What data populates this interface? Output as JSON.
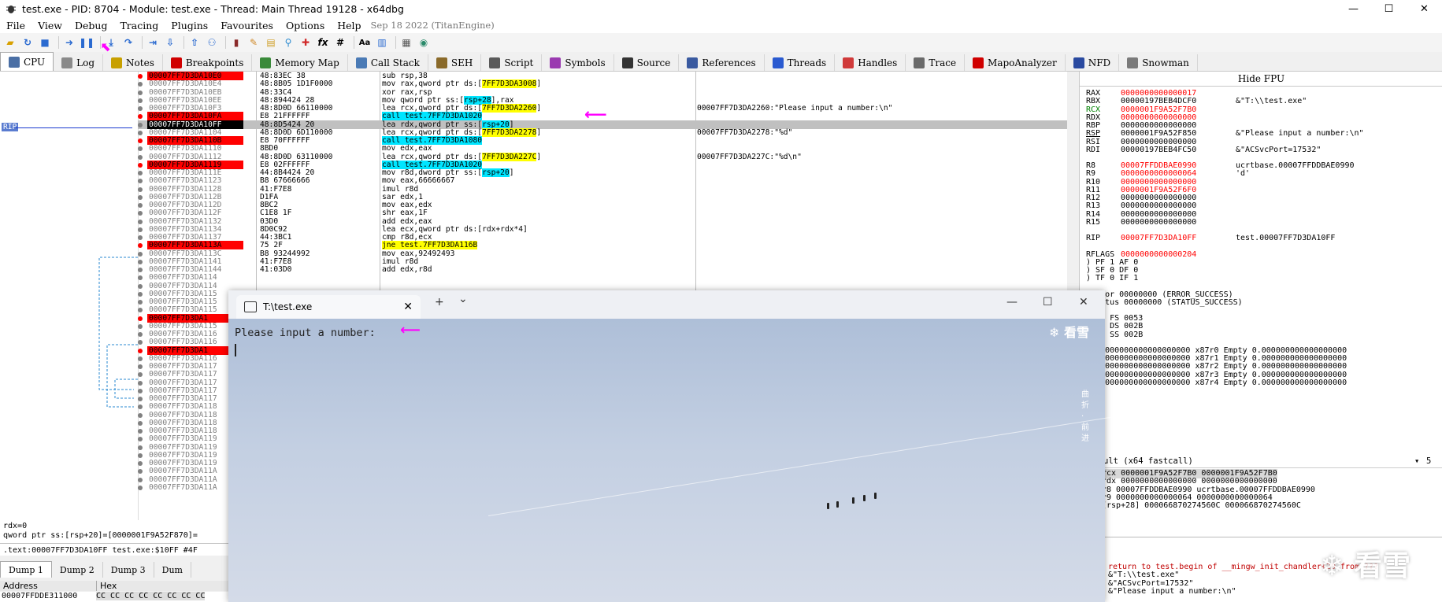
{
  "window": {
    "title": "test.exe - PID: 8704 - Module: test.exe - Thread: Main Thread 19128 - x64dbg",
    "minimize": "—",
    "maximize": "☐",
    "close": "✕"
  },
  "menu": {
    "items": [
      "File",
      "View",
      "Debug",
      "Tracing",
      "Plugins",
      "Favourites",
      "Options",
      "Help"
    ],
    "build_date": "Sep 18 2022 (TitanEngine)"
  },
  "tabs": [
    {
      "label": "CPU",
      "color": "#4a6fa5"
    },
    {
      "label": "Log",
      "color": "#8a8a8a"
    },
    {
      "label": "Notes",
      "color": "#c8a000"
    },
    {
      "label": "Breakpoints",
      "color": "#d00000"
    },
    {
      "label": "Memory Map",
      "color": "#3a8a3a"
    },
    {
      "label": "Call Stack",
      "color": "#4a7ab5"
    },
    {
      "label": "SEH",
      "color": "#8a6a2a"
    },
    {
      "label": "Script",
      "color": "#5a5a5a"
    },
    {
      "label": "Symbols",
      "color": "#9a3ab0"
    },
    {
      "label": "Source",
      "color": "#333333"
    },
    {
      "label": "References",
      "color": "#3a5aa0"
    },
    {
      "label": "Threads",
      "color": "#2a5ad0"
    },
    {
      "label": "Handles",
      "color": "#d03a3a"
    },
    {
      "label": "Trace",
      "color": "#6a6a6a"
    },
    {
      "label": "MapoAnalyzer",
      "color": "#d00000"
    },
    {
      "label": "NFD",
      "color": "#2a4aa0"
    },
    {
      "label": "Snowman",
      "color": "#7a7a7a"
    }
  ],
  "rip_label": "RIP",
  "disasm": [
    {
      "addr": "00007FF7D3DA10E0",
      "bp": true,
      "bytes": "48:83EC 38",
      "asm": "sub rsp,38",
      "comment": ""
    },
    {
      "addr": "00007FF7D3DA10E4",
      "bp": false,
      "bytes": "48:8B05 1D1F0000",
      "asm_pre": "mov rax,qword ptr ds:[",
      "asm_hl": "7FF7D3DA3008",
      "asm_post": "]",
      "hl": "y",
      "comment": ""
    },
    {
      "addr": "00007FF7D3DA10EB",
      "bp": false,
      "bytes": "48:33C4",
      "asm": "xor rax,rsp",
      "comment": ""
    },
    {
      "addr": "00007FF7D3DA10EE",
      "bp": false,
      "bytes": "48:894424 28",
      "asm_pre": "mov qword ptr ss:[",
      "asm_hl": "rsp+28",
      "asm_post": "],rax",
      "hl": "c",
      "comment": ""
    },
    {
      "addr": "00007FF7D3DA10F3",
      "bp": false,
      "bytes": "48:8D0D 66110000",
      "asm_pre": "lea rcx,qword ptr ds:[",
      "asm_hl": "7FF7D3DA2260",
      "asm_post": "]",
      "hl": "y",
      "comment": "00007FF7D3DA2260:\"Please input a number:\\n\""
    },
    {
      "addr": "00007FF7D3DA10FA",
      "bp": true,
      "bytes": "E8 21FFFFFF",
      "asm_pre": "",
      "asm_hl": "call test.7FF7D3DA1020",
      "asm_post": "",
      "hl": "c",
      "comment": ""
    },
    {
      "addr": "00007FF7D3DA10FF",
      "bp": false,
      "cur": true,
      "bytes": "48:8D5424 20",
      "asm_pre": "lea rdx,qword ptr ss:[",
      "asm_hl": "rsp+20",
      "asm_post": "]",
      "hl": "c",
      "comment": ""
    },
    {
      "addr": "00007FF7D3DA1104",
      "bp": false,
      "bytes": "48:8D0D 6D110000",
      "asm_pre": "lea rcx,qword ptr ds:[",
      "asm_hl": "7FF7D3DA2278",
      "asm_post": "]",
      "hl": "y",
      "comment": "00007FF7D3DA2278:\"%d\""
    },
    {
      "addr": "00007FF7D3DA110B",
      "bp": true,
      "bytes": "E8 70FFFFFF",
      "asm_pre": "",
      "asm_hl": "call test.7FF7D3DA1080",
      "asm_post": "",
      "hl": "c",
      "comment": ""
    },
    {
      "addr": "00007FF7D3DA1110",
      "bp": false,
      "bytes": "8BD0",
      "asm": "mov edx,eax",
      "comment": ""
    },
    {
      "addr": "00007FF7D3DA1112",
      "bp": false,
      "bytes": "48:8D0D 63110000",
      "asm_pre": "lea rcx,qword ptr ds:[",
      "asm_hl": "7FF7D3DA227C",
      "asm_post": "]",
      "hl": "y",
      "comment": "00007FF7D3DA227C:\"%d\\n\""
    },
    {
      "addr": "00007FF7D3DA1119",
      "bp": true,
      "bytes": "E8 02FFFFFF",
      "asm_pre": "",
      "asm_hl": "call test.7FF7D3DA1020",
      "asm_post": "",
      "hl": "c",
      "comment": ""
    },
    {
      "addr": "00007FF7D3DA111E",
      "bp": false,
      "bytes": "44:8B4424 20",
      "asm_pre": "mov r8d,dword ptr ss:[",
      "asm_hl": "rsp+20",
      "asm_post": "]",
      "hl": "c",
      "comment": ""
    },
    {
      "addr": "00007FF7D3DA1123",
      "bp": false,
      "bytes": "B8 67666666",
      "asm": "mov eax,66666667",
      "comment": ""
    },
    {
      "addr": "00007FF7D3DA1128",
      "bp": false,
      "bytes": "41:F7E8",
      "asm": "imul r8d",
      "comment": ""
    },
    {
      "addr": "00007FF7D3DA112B",
      "bp": false,
      "bytes": "D1FA",
      "asm": "sar edx,1",
      "comment": ""
    },
    {
      "addr": "00007FF7D3DA112D",
      "bp": false,
      "bytes": "8BC2",
      "asm": "mov eax,edx",
      "comment": ""
    },
    {
      "addr": "00007FF7D3DA112F",
      "bp": false,
      "bytes": "C1E8 1F",
      "asm": "shr eax,1F",
      "comment": ""
    },
    {
      "addr": "00007FF7D3DA1132",
      "bp": false,
      "bytes": "03D0",
      "asm": "add edx,eax",
      "comment": ""
    },
    {
      "addr": "00007FF7D3DA1134",
      "bp": false,
      "bytes": "8D0C92",
      "asm": "lea ecx,qword ptr ds:[rdx+rdx*4]",
      "comment": ""
    },
    {
      "addr": "00007FF7D3DA1137",
      "bp": false,
      "bytes": "44:3BC1",
      "asm": "cmp r8d,ecx",
      "comment": ""
    },
    {
      "addr": "00007FF7D3DA113A",
      "bp": true,
      "bytes": "75 2F",
      "asm_pre": "",
      "asm_hl": "jne test.7FF7D3DA116B",
      "asm_post": "",
      "hl": "y",
      "comment": ""
    },
    {
      "addr": "00007FF7D3DA113C",
      "bp": false,
      "bytes": "B8 93244992",
      "asm": "mov eax,92492493",
      "comment": ""
    },
    {
      "addr": "00007FF7D3DA1141",
      "bp": false,
      "bytes": "41:F7E8",
      "asm": "imul r8d",
      "comment": ""
    },
    {
      "addr": "00007FF7D3DA1144",
      "bp": false,
      "bytes": "41:03D0",
      "asm": "add edx,r8d",
      "comment": ""
    }
  ],
  "disasm_more": [
    {
      "addr": "00007FF7D3DA114",
      "bp": false
    },
    {
      "addr": "00007FF7D3DA114",
      "bp": false
    },
    {
      "addr": "00007FF7D3DA115",
      "bp": false
    },
    {
      "addr": "00007FF7D3DA115",
      "bp": false
    },
    {
      "addr": "00007FF7D3DA115",
      "bp": false
    },
    {
      "addr": "00007FF7D3DA1",
      "bp": true
    },
    {
      "addr": "00007FF7D3DA115",
      "bp": false
    },
    {
      "addr": "00007FF7D3DA116",
      "bp": false
    },
    {
      "addr": "00007FF7D3DA116",
      "bp": false
    },
    {
      "addr": "00007FF7D3DA1",
      "bp": true
    },
    {
      "addr": "00007FF7D3DA116",
      "bp": false
    },
    {
      "addr": "00007FF7D3DA117",
      "bp": false
    },
    {
      "addr": "00007FF7D3DA117",
      "bp": false
    },
    {
      "addr": "00007FF7D3DA117",
      "bp": false
    },
    {
      "addr": "00007FF7D3DA117",
      "bp": false
    },
    {
      "addr": "00007FF7D3DA117",
      "bp": false
    },
    {
      "addr": "00007FF7D3DA118",
      "bp": false
    },
    {
      "addr": "00007FF7D3DA118",
      "bp": false
    },
    {
      "addr": "00007FF7D3DA118",
      "bp": false
    },
    {
      "addr": "00007FF7D3DA118",
      "bp": false
    },
    {
      "addr": "00007FF7D3DA119",
      "bp": false
    },
    {
      "addr": "00007FF7D3DA119",
      "bp": false
    },
    {
      "addr": "00007FF7D3DA119",
      "bp": false
    },
    {
      "addr": "00007FF7D3DA119",
      "bp": false
    },
    {
      "addr": "00007FF7D3DA11A",
      "bp": false
    },
    {
      "addr": "00007FF7D3DA11A",
      "bp": false
    },
    {
      "addr": "00007FF7D3DA11A",
      "bp": false
    }
  ],
  "info": {
    "line1": "rdx=0",
    "line2": "qword ptr ss:[rsp+20]=[0000001F9A52F870]=",
    "line3": ".text:00007FF7D3DA10FF test.exe:$10FF #4F"
  },
  "dump_tabs": [
    "Dump 1",
    "Dump 2",
    "Dump 3",
    "Dum"
  ],
  "dump_header": {
    "address": "Address",
    "hex": "Hex"
  },
  "dump_row": {
    "address": "00007FFDDE311000",
    "hex": "CC CC CC CC  CC CC CC CC"
  },
  "regs": {
    "hide_fpu": "Hide FPU",
    "gp": [
      {
        "name": "RAX",
        "value": "0000000000000017",
        "changed": true,
        "comment": ""
      },
      {
        "name": "RBX",
        "value": "00000197BEB4DCF0",
        "changed": false,
        "comment": "&\"T:\\\\test.exe\""
      },
      {
        "name": "RCX",
        "value": "0000001F9A52F7B0",
        "changed": true,
        "name_green": true,
        "comment": ""
      },
      {
        "name": "RDX",
        "value": "0000000000000000",
        "changed": true,
        "comment": ""
      },
      {
        "name": "RBP",
        "value": "0000000000000000",
        "changed": false,
        "comment": ""
      },
      {
        "name": "RSP",
        "value": "0000001F9A52F850",
        "changed": false,
        "underline": true,
        "comment": "&\"Please input a number:\\n\""
      },
      {
        "name": "RSI",
        "value": "0000000000000000",
        "changed": false,
        "comment": ""
      },
      {
        "name": "RDI",
        "value": "00000197BEB4FC50",
        "changed": false,
        "comment": "&\"ACSvcPort=17532\""
      }
    ],
    "ext": [
      {
        "name": "R8",
        "value": "00007FFDDBAE0990",
        "changed": true,
        "comment": "ucrtbase.00007FFDDBAE0990"
      },
      {
        "name": "R9",
        "value": "0000000000000064",
        "changed": true,
        "comment": "'d'"
      },
      {
        "name": "R10",
        "value": "0000000000000000",
        "changed": true,
        "comment": ""
      },
      {
        "name": "R11",
        "value": "0000001F9A52F6F0",
        "changed": true,
        "comment": ""
      },
      {
        "name": "R12",
        "value": "0000000000000000",
        "changed": false,
        "comment": ""
      },
      {
        "name": "R13",
        "value": "0000000000000000",
        "changed": false,
        "comment": ""
      },
      {
        "name": "R14",
        "value": "0000000000000000",
        "changed": false,
        "comment": ""
      },
      {
        "name": "R15",
        "value": "0000000000000000",
        "changed": false,
        "comment": ""
      }
    ],
    "rip": {
      "name": "RIP",
      "value": "00007FF7D3DA10FF",
      "comment": "test.00007FF7D3DA10FF"
    },
    "rflags_label": "RFLAGS",
    "rflags_value": "0000000000000204",
    "flags": [
      ") PF 1  AF 0",
      ") SF 0  DF 0",
      ") TF 0  IF 1"
    ],
    "last_error": "tError  00000000 (ERROR_SUCCESS)",
    "last_status": "tStatus 00000000 (STATUS_SUCCESS)",
    "segs": [
      "002B  FS 0053",
      "002B  DS 002B",
      "0033  SS 002B"
    ],
    "fpu": [
      ")) 0000000000000000000 x87r0 Empty 0.000000000000000000",
      ")) 0000000000000000000 x87r1 Empty 0.000000000000000000",
      ")) 0000000000000000000 x87r2 Empty 0.000000000000000000",
      ")) 0000000000000000000 x87r3 Empty 0.000000000000000000",
      ")) 0000000000000000000 x87r4 Empty 0.000000000000000000"
    ]
  },
  "callconv": {
    "selector": "ult (x64 fastcall)",
    "count": "5",
    "rows": [
      "rcx 0000001F9A52F7B0 0000001F9A52F7B0",
      "rdx 0000000000000000 0000000000000000",
      "r8 00007FFDDBAE0990 ucrtbase.00007FFDDBAE0990",
      "r9 0000000000000064 0000000000000064",
      "[rsp+28] 000066870274560C 000066870274560C"
    ]
  },
  "stack": {
    "rows": [
      "return to test.begin of __mingw_init_chandler+20 from ???",
      "&\"T:\\\\test.exe\"",
      "&\"ACSvcPort=17532\"",
      "&\"Please input a number:\\n\""
    ]
  },
  "console": {
    "tab_title": "T:\\test.exe",
    "close": "✕",
    "new_tab": "+",
    "dropdown": "⌄",
    "min": "—",
    "max": "☐",
    "win_close": "✕",
    "prompt": "Please input a number:",
    "watermark": "❄ 看雪",
    "vertical_mark": "曲 折 · 前 进"
  },
  "corner_watermark": "❄ 看雪",
  "accent": {
    "breakpoint": "#ff0000",
    "highlight_yellow": "#ffff00",
    "highlight_cyan": "#00e5ff",
    "annotation": "#ff00ff"
  }
}
